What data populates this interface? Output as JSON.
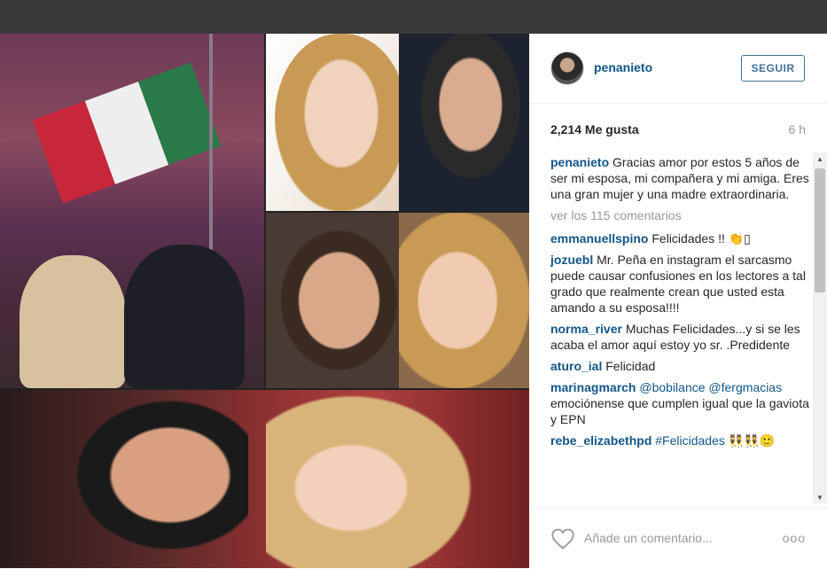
{
  "post": {
    "username": "penanieto",
    "follow_label": "SEGUIR",
    "likes": "2,214 Me gusta",
    "time": "6 h",
    "caption_user": "penanieto",
    "caption_text": "Gracias amor por estos 5 años de ser mi esposa, mi compañera y mi amiga. Eres una gran mujer y una madre extraordinaria.",
    "view_all": "ver los 115 comentarios",
    "comments": [
      {
        "user": "emmanuellspino",
        "text": "Felicidades !! 👏▯"
      },
      {
        "user": "jozuebl",
        "text": "Mr. Peña en instagram el sarcasmo puede causar confusiones en los lectores a tal grado que realmente crean que usted esta amando a su esposa!!!!"
      },
      {
        "user": "norma_river",
        "text": "Muchas Felicidades...y si se les acaba el amor aquí estoy yo sr. .Predidente"
      },
      {
        "user": "aturo_ial",
        "text": "Felicidad"
      },
      {
        "user": "marinagmarch",
        "mentions": "@bobilance @fergmacias",
        "text": "emociónense que cumplen igual que la gaviota y EPN"
      },
      {
        "user": "rebe_elizabethpd",
        "mentions": "#Felicidades",
        "text": "👯👯🙂"
      }
    ],
    "add_comment_placeholder": "Añade un comentario...",
    "more_label": "ooo"
  },
  "colors": {
    "link": "#125688",
    "follow_border": "#3f729b",
    "muted": "#999999",
    "topbar": "#3a3a3a"
  },
  "icons": {
    "heart": "heart-outline-icon",
    "more": "more-options-icon",
    "scroll_up": "scroll-up-arrow-icon",
    "scroll_down": "scroll-down-arrow-icon"
  }
}
